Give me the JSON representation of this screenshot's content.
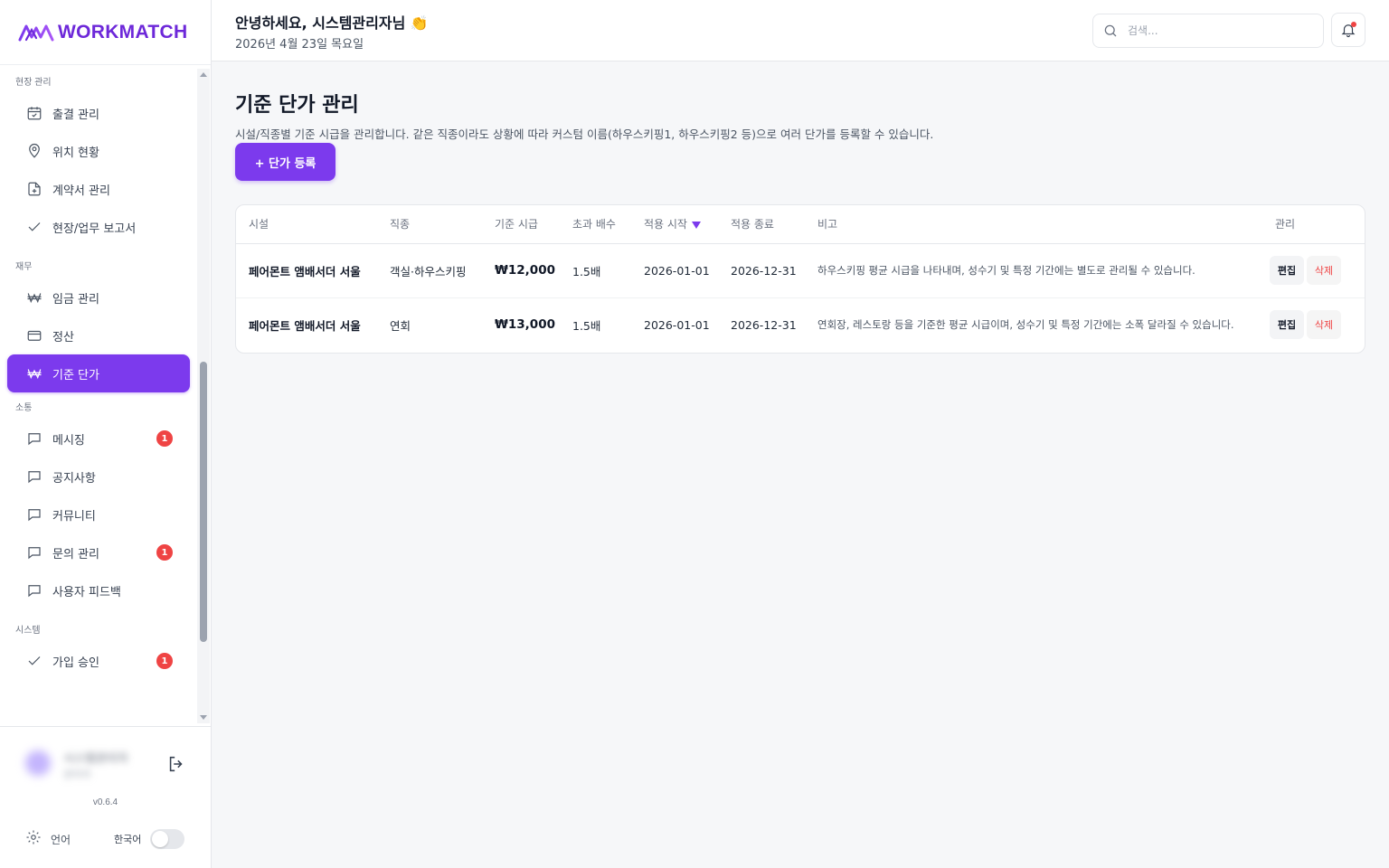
{
  "app": {
    "logo_text": "WORKMATCH",
    "version": "v0.6.4"
  },
  "header": {
    "greeting": "안녕하세요, 시스템관리자님 👏",
    "date": "2026년 4월 23일 목요일",
    "search_placeholder": "검색..."
  },
  "sidebar": {
    "sections": [
      {
        "label": "현장 관리",
        "items": [
          {
            "label": "출결 관리",
            "icon": "calendar-check-icon"
          },
          {
            "label": "위치 현황",
            "icon": "map-pin-icon"
          },
          {
            "label": "계약서 관리",
            "icon": "file-plus-icon"
          },
          {
            "label": "현장/업무 보고서",
            "icon": "check-icon"
          }
        ]
      },
      {
        "label": "재무",
        "items": [
          {
            "label": "임금 관리",
            "icon": "won-icon"
          },
          {
            "label": "정산",
            "icon": "credit-card-icon"
          },
          {
            "label": "기준 단가",
            "icon": "won-icon",
            "active": true
          }
        ]
      },
      {
        "label": "소통",
        "items": [
          {
            "label": "메시징",
            "icon": "message-icon",
            "badge": "1"
          },
          {
            "label": "공지사항",
            "icon": "message-icon"
          },
          {
            "label": "커뮤니티",
            "icon": "message-icon"
          },
          {
            "label": "문의 관리",
            "icon": "message-icon",
            "badge": "1"
          },
          {
            "label": "사용자 피드백",
            "icon": "message-icon"
          }
        ]
      },
      {
        "label": "시스템",
        "items": [
          {
            "label": "가입 승인",
            "icon": "check-icon",
            "badge": "1"
          }
        ]
      }
    ],
    "footer": {
      "user_name": "시스템관리자",
      "user_role": "관리자",
      "language_label": "언어",
      "language_value": "한국어"
    }
  },
  "main": {
    "title": "기준 단가 관리",
    "description": "시설/직종별 기준 시급을 관리합니다. 같은 직종이라도 상황에 따라 커스텀 이름(하우스키핑1, 하우스키핑2 등)으로 여러 단가를 등록할 수 있습니다.",
    "add_button": "+ 단가 등록",
    "table": {
      "columns": [
        "시설",
        "직종",
        "기준 시급",
        "초과 배수",
        "적용 시작",
        "적용 종료",
        "비고",
        "관리"
      ],
      "sorted_column": "적용 시작",
      "rows": [
        {
          "facility": "페어몬트 앰배서더 서울",
          "job": "객실·하우스키핑",
          "rate": "₩12,000",
          "multiplier": "1.5배",
          "start": "2026-01-01",
          "end": "2026-12-31",
          "note": "하우스키핑 평균 시급을 나타내며, 성수기 및 특정 기간에는 별도로 관리될 수 있습니다.",
          "edit": "편집",
          "delete": "삭제"
        },
        {
          "facility": "페어몬트 앰배서더 서울",
          "job": "연회",
          "rate": "₩13,000",
          "multiplier": "1.5배",
          "start": "2026-01-01",
          "end": "2026-12-31",
          "note": "연회장, 레스토랑 등을 기준한 평균 시급이며, 성수기 및 특정 기간에는 소폭 달라질 수 있습니다.",
          "edit": "편집",
          "delete": "삭제"
        }
      ]
    }
  },
  "colors": {
    "accent": "#7c3aed",
    "badge": "#ef4444",
    "delete": "#ef4444"
  }
}
